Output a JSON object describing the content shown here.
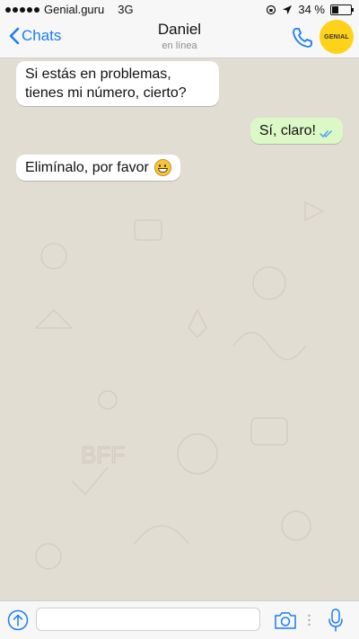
{
  "status_bar": {
    "carrier": "Genial.guru",
    "network": "3G",
    "battery_percent_label": "34 %",
    "battery_level": 0.34
  },
  "header": {
    "back_label": "Chats",
    "contact_name": "Daniel",
    "contact_status": "en línea",
    "logo_text": "GENIAL"
  },
  "messages": [
    {
      "direction": "incoming",
      "text": "Si estás en problemas, tienes mi número, cierto?"
    },
    {
      "direction": "outgoing",
      "text": "Sí, claro!",
      "read_ticks": "double-check-icon"
    },
    {
      "direction": "incoming",
      "text": "Elimínalo, por favor",
      "emoji": "grinning-face-emoji"
    }
  ],
  "input_bar": {
    "placeholder": "",
    "icons": [
      "upload-icon",
      "camera-icon",
      "microphone-icon"
    ]
  },
  "colors": {
    "accent": "#1a7cf5",
    "outgoing_bubble": "#dcf8c6",
    "incoming_bubble": "#ffffff",
    "chat_background": "#e2ddd3",
    "logo_yellow": "#ffd21a"
  }
}
